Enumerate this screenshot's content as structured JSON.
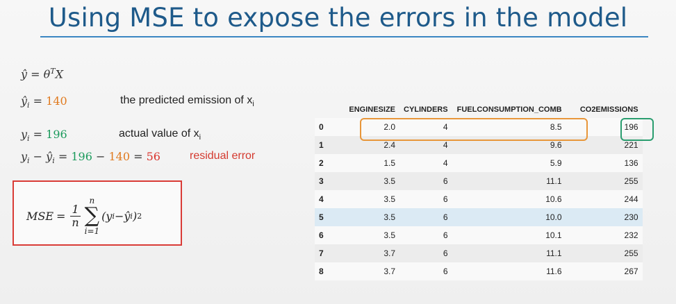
{
  "title": "Using MSE to expose the errors in the model",
  "equations": {
    "yhat_symbol": "ŷ",
    "eq1_rhs": "θ",
    "eq1_sup": "T",
    "eq1_x": "X",
    "yhat_i_value": "140",
    "y_i_value": "196",
    "residual_eq": "= 196 − 140 = 56",
    "residual_a": "196",
    "residual_b": "140",
    "residual_c": "56"
  },
  "labels": {
    "predicted": "the predicted emission of x",
    "actual": "actual value of x",
    "residual": "residual error",
    "sub_i": "i"
  },
  "mse": {
    "lhs": "MSE",
    "frac_num": "1",
    "frac_den": "n",
    "sum_top": "n",
    "sum_bot": "i=1"
  },
  "table": {
    "columns": [
      "ENGINESIZE",
      "CYLINDERS",
      "FUELCONSUMPTION_COMB",
      "CO2EMISSIONS"
    ],
    "rows": [
      {
        "idx": "0",
        "enginesize": "2.0",
        "cylinders": "4",
        "fuel": "8.5",
        "co2": "196"
      },
      {
        "idx": "1",
        "enginesize": "2.4",
        "cylinders": "4",
        "fuel": "9.6",
        "co2": "221"
      },
      {
        "idx": "2",
        "enginesize": "1.5",
        "cylinders": "4",
        "fuel": "5.9",
        "co2": "136"
      },
      {
        "idx": "3",
        "enginesize": "3.5",
        "cylinders": "6",
        "fuel": "11.1",
        "co2": "255"
      },
      {
        "idx": "4",
        "enginesize": "3.5",
        "cylinders": "6",
        "fuel": "10.6",
        "co2": "244"
      },
      {
        "idx": "5",
        "enginesize": "3.5",
        "cylinders": "6",
        "fuel": "10.0",
        "co2": "230"
      },
      {
        "idx": "6",
        "enginesize": "3.5",
        "cylinders": "6",
        "fuel": "10.1",
        "co2": "232"
      },
      {
        "idx": "7",
        "enginesize": "3.7",
        "cylinders": "6",
        "fuel": "11.1",
        "co2": "255"
      },
      {
        "idx": "8",
        "enginesize": "3.7",
        "cylinders": "6",
        "fuel": "11.6",
        "co2": "267"
      }
    ]
  },
  "colors": {
    "title": "#1e5a8a",
    "predicted": "#e07a1f",
    "actual": "#1a9a5b",
    "residual": "#d9322b",
    "highlight_row": "#dbeaf4"
  }
}
